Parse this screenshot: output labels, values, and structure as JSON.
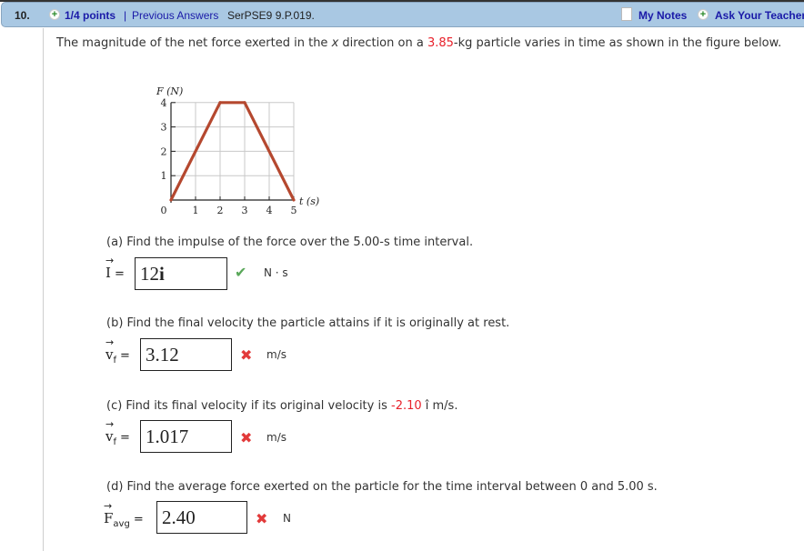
{
  "header": {
    "question_number": "10.",
    "points": "1/4 points",
    "separator": "|",
    "previous_answers": "Previous Answers",
    "problem_code": "SerPSE9 9.P.019.",
    "my_notes": "My Notes",
    "ask_teacher": "Ask Your Teacher",
    "plus_glyph": "+"
  },
  "prompt": {
    "text_before": "The magnitude of the net force exerted in the ",
    "var_x": "x",
    "text_mid": " direction on a ",
    "mass": "3.85",
    "text_after": "-kg particle varies in time as shown in the figure below."
  },
  "chart_data": {
    "type": "line",
    "title": "",
    "xlabel": "t (s)",
    "ylabel": "F (N)",
    "x": [
      0,
      2,
      3,
      5
    ],
    "y": [
      0,
      4,
      4,
      0
    ],
    "xlim": [
      0,
      5
    ],
    "ylim": [
      0,
      4
    ],
    "x_ticks": [
      "0",
      "1",
      "2",
      "3",
      "4",
      "5"
    ],
    "y_ticks": [
      "1",
      "2",
      "3",
      "4"
    ],
    "grid": true,
    "line_color": "#b5482f"
  },
  "parts": [
    {
      "question": "(a) Find the impulse of the force over the 5.00-s time interval.",
      "symbol": "I",
      "subscript": "",
      "equals": "=",
      "answer_value": "12",
      "answer_unit_vector": "i",
      "status": "correct",
      "status_glyph": "✔",
      "unit": "N · s"
    },
    {
      "question": "(b) Find the final velocity the particle attains if it is originally at rest.",
      "symbol": "v",
      "subscript": "f",
      "equals": "=",
      "answer_value": "3.12",
      "status": "incorrect",
      "status_glyph": "✖",
      "unit": "m/s"
    },
    {
      "question_before": "(c) Find its final velocity if its original velocity is ",
      "initial_velocity": "-2.10",
      "question_after": " î m/s.",
      "symbol": "v",
      "subscript": "f",
      "equals": "=",
      "answer_value": "1.017",
      "status": "incorrect",
      "status_glyph": "✖",
      "unit": "m/s"
    },
    {
      "question": "(d) Find the average force exerted on the particle for the time interval between 0 and 5.00 s.",
      "symbol": "F",
      "subscript": "avg",
      "equals": "=",
      "answer_value": "2.40",
      "status": "incorrect",
      "status_glyph": "✖",
      "unit": "N"
    }
  ]
}
